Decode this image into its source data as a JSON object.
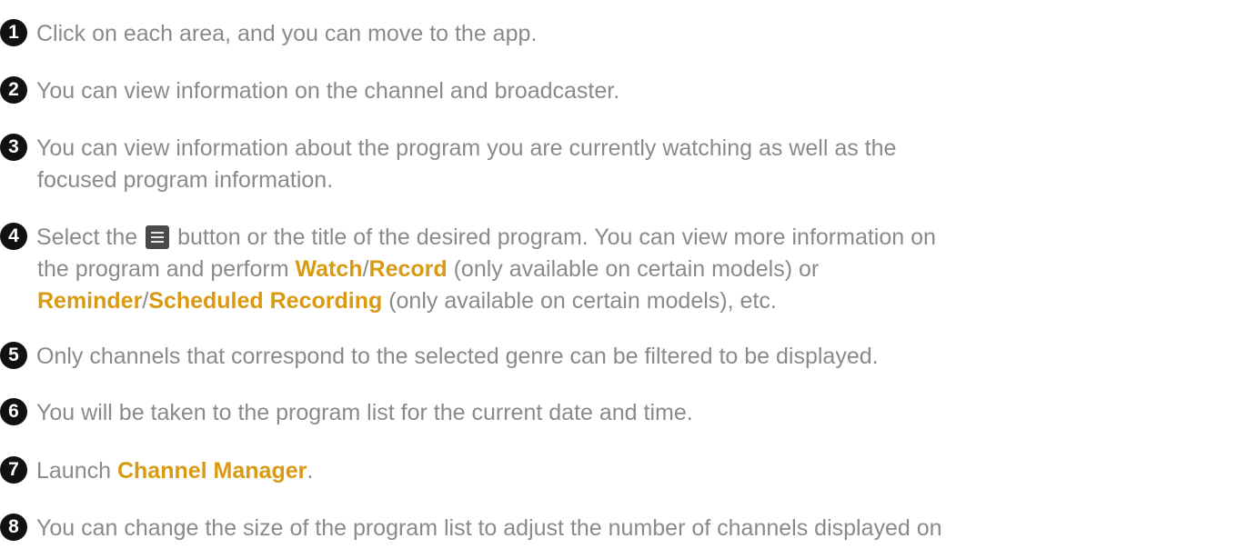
{
  "items": [
    {
      "number": "1",
      "line1": "Click on each area, and you can move to the app."
    },
    {
      "number": "2",
      "line1": "You can view information on the channel and broadcaster."
    },
    {
      "number": "3",
      "line1": "You can view information about the program you are currently watching as well as the",
      "line2": "focused program information."
    },
    {
      "number": "4",
      "line1_pre": "Select the",
      "icon": "menu-icon",
      "line1_post": "button or the title of the desired program. You can view more information on",
      "line2_pre": "the program and perform ",
      "watch": "Watch",
      "slash1": "/",
      "record": "Record",
      "line2_post": " (only available on certain models) or",
      "reminder": "Reminder",
      "slash2": "/",
      "scheduled": "Scheduled Recording",
      "line3_post": " (only available on certain models), etc."
    },
    {
      "number": "5",
      "line1": "Only channels that correspond to the selected genre can be filtered to be displayed."
    },
    {
      "number": "6",
      "line1": "You will be taken to the program list for the current date and time."
    },
    {
      "number": "7",
      "line1_pre": "Launch ",
      "manager": "Channel Manager",
      "line1_post": "."
    },
    {
      "number": "8",
      "line1": "You can change the size of the program list to adjust the number of channels displayed on"
    }
  ],
  "colors": {
    "text": "#8a8a8a",
    "highlight": "#d99a12",
    "badge": "#111111"
  }
}
